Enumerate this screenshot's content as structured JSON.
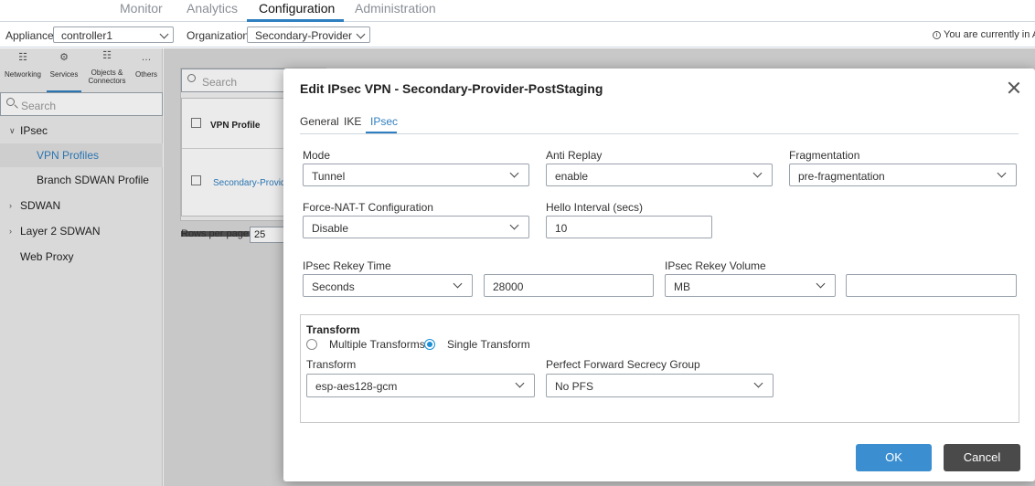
{
  "topnav": {
    "monitor": "Monitor",
    "analytics": "Analytics",
    "configuration": "Configuration",
    "administration": "Administration"
  },
  "subbar": {
    "appliance_label": "Appliance",
    "appliance_value": "controller1",
    "organization_label": "Organization",
    "organization_value": "Secondary-Provider",
    "status_text": "You are currently in A"
  },
  "sidebar": {
    "icon_tabs": [
      {
        "label": "Networking",
        "icon": "networking-icon"
      },
      {
        "label": "Services",
        "icon": "services-icon"
      },
      {
        "label": "Objects & Connectors",
        "icon": "objects-connectors-icon"
      },
      {
        "label": "Others",
        "icon": "others-icon"
      }
    ],
    "search_placeholder": "Search",
    "tree": {
      "ipsec": "IPsec",
      "vpn_profiles": "VPN Profiles",
      "branch_sdwan_profile": "Branch SDWAN Profile",
      "sdwan": "SDWAN",
      "layer2_sdwan": "Layer 2 SDWAN",
      "web_proxy": "Web Proxy"
    }
  },
  "background": {
    "search_placeholder": "Search",
    "column_header": "VPN Profile",
    "row_value": "Secondary-Provide",
    "rows_per_page_label": "Rows per page",
    "rows_per_page_value": "25"
  },
  "dialog": {
    "title": "Edit IPsec VPN - Secondary-Provider-PostStaging",
    "tabs": {
      "general": "General",
      "ike": "IKE",
      "ipsec": "IPsec"
    },
    "mode": {
      "label": "Mode",
      "value": "Tunnel"
    },
    "anti_replay": {
      "label": "Anti Replay",
      "value": "enable"
    },
    "fragmentation": {
      "label": "Fragmentation",
      "value": "pre-fragmentation"
    },
    "force_nat": {
      "label": "Force-NAT-T Configuration",
      "value": "Disable"
    },
    "hello_interval": {
      "label": "Hello Interval (secs)",
      "value": "10"
    },
    "rekey_time": {
      "label": "IPsec Rekey Time",
      "unit": "Seconds",
      "value": "28000"
    },
    "rekey_volume": {
      "label": "IPsec Rekey Volume",
      "unit": "MB",
      "value": ""
    },
    "transform_section": {
      "title": "Transform",
      "multiple_label": "Multiple Transforms",
      "single_label": "Single Transform",
      "transform": {
        "label": "Transform",
        "value": "esp-aes128-gcm"
      },
      "pfs": {
        "label": "Perfect Forward Secrecy Group",
        "value": "No PFS"
      }
    },
    "ok_label": "OK",
    "cancel_label": "Cancel"
  },
  "colors": {
    "accent": "#2f7fc1",
    "ok_button": "#3b8fd0",
    "cancel_button": "#4a4a4a"
  }
}
